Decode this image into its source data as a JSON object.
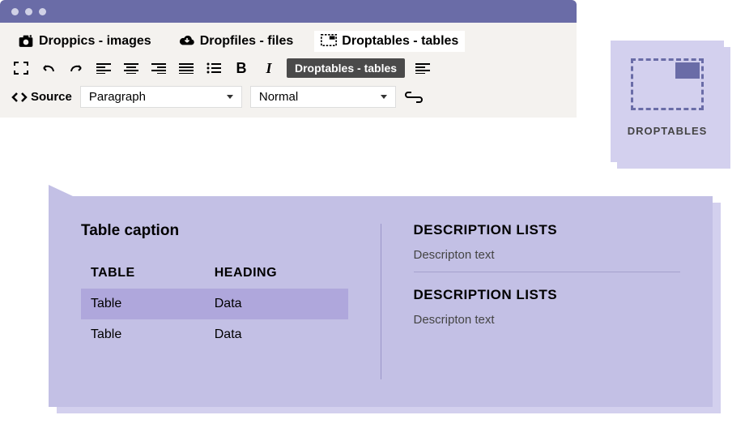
{
  "window": {
    "tabs": [
      {
        "label": "Droppics - images"
      },
      {
        "label": "Dropfiles - files"
      },
      {
        "label": "Droptables - tables"
      }
    ],
    "tooltip": "Droptables - tables",
    "source_label": "Source",
    "dropdown1": "Paragraph",
    "dropdown2": "Normal"
  },
  "sidecard": {
    "label": "DROPTABLES"
  },
  "content": {
    "caption": "Table caption",
    "table": {
      "headers": [
        "TABLE",
        "HEADING"
      ],
      "rows": [
        [
          "Table",
          "Data"
        ],
        [
          "Table",
          "Data"
        ]
      ]
    },
    "lists": [
      {
        "title": "DESCRIPTION LISTS",
        "text": "Descripton text"
      },
      {
        "title": "DESCRIPTION LISTS",
        "text": "Descripton text"
      }
    ]
  }
}
